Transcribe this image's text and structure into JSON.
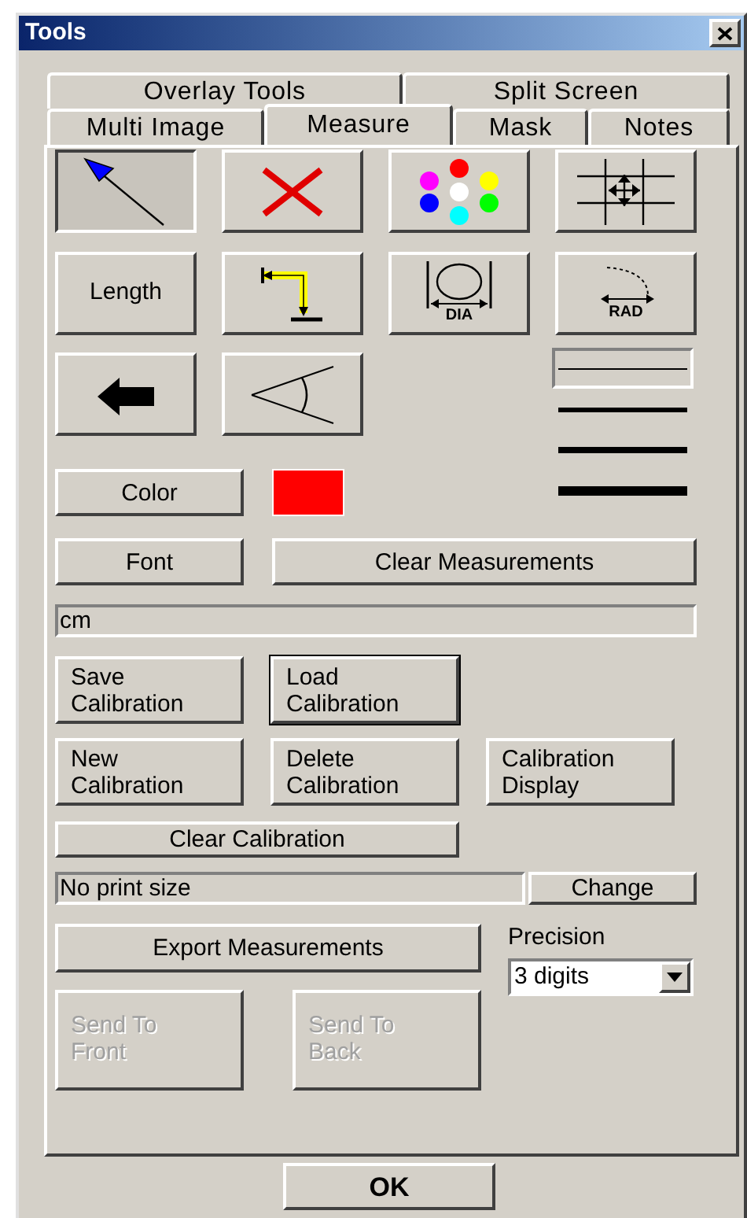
{
  "window": {
    "title": "Tools"
  },
  "tabs_row_1": [
    {
      "label": "Overlay Tools",
      "selected": false
    },
    {
      "label": "Split Screen",
      "selected": false
    }
  ],
  "tabs_row_2": [
    {
      "label": "Multi Image",
      "selected": false
    },
    {
      "label": "Measure",
      "selected": true
    },
    {
      "label": "Mask",
      "selected": false
    },
    {
      "label": "Notes",
      "selected": false
    }
  ],
  "tools": [
    {
      "kind": "pointer",
      "selected": true
    },
    {
      "kind": "delete",
      "selected": false
    },
    {
      "kind": "colors",
      "selected": false
    },
    {
      "kind": "move",
      "selected": false
    },
    {
      "kind": "text",
      "label": "Length",
      "selected": false
    },
    {
      "kind": "path",
      "selected": false
    },
    {
      "kind": "diameter",
      "label": "DIA",
      "selected": false
    },
    {
      "kind": "radius",
      "label": "RAD",
      "selected": false
    },
    {
      "kind": "arrowhead",
      "selected": false
    },
    {
      "kind": "angle",
      "selected": false
    }
  ],
  "line_widths": [
    {
      "selected": true
    },
    {
      "selected": false
    },
    {
      "selected": false
    },
    {
      "selected": false
    }
  ],
  "color_button": "Color",
  "color_swatch": {
    "color": "#ff0000"
  },
  "font_button": "Font",
  "clear_measurements_button": "Clear Measurements",
  "units_field": {
    "value": "cm"
  },
  "calibration_rows": [
    [
      {
        "label": "Save\nCalibration",
        "focused": false
      },
      {
        "label": "Load\nCalibration",
        "focused": true
      }
    ],
    [
      {
        "label": "New\nCalibration",
        "focused": false
      },
      {
        "label": "Delete\nCalibration",
        "focused": false
      },
      {
        "label": "Calibration\nDisplay",
        "focused": false
      }
    ]
  ],
  "clear_calibration_button": "Clear Calibration",
  "print_size": {
    "value": "No print size"
  },
  "change_button": "Change",
  "export_button": "Export Measurements",
  "precision": {
    "label": "Precision",
    "value": "3 digits"
  },
  "order_buttons": [
    {
      "label": "Send To\nFront",
      "disabled": true
    },
    {
      "label": "Send To\nBack",
      "disabled": true
    }
  ],
  "ok_button": "OK"
}
